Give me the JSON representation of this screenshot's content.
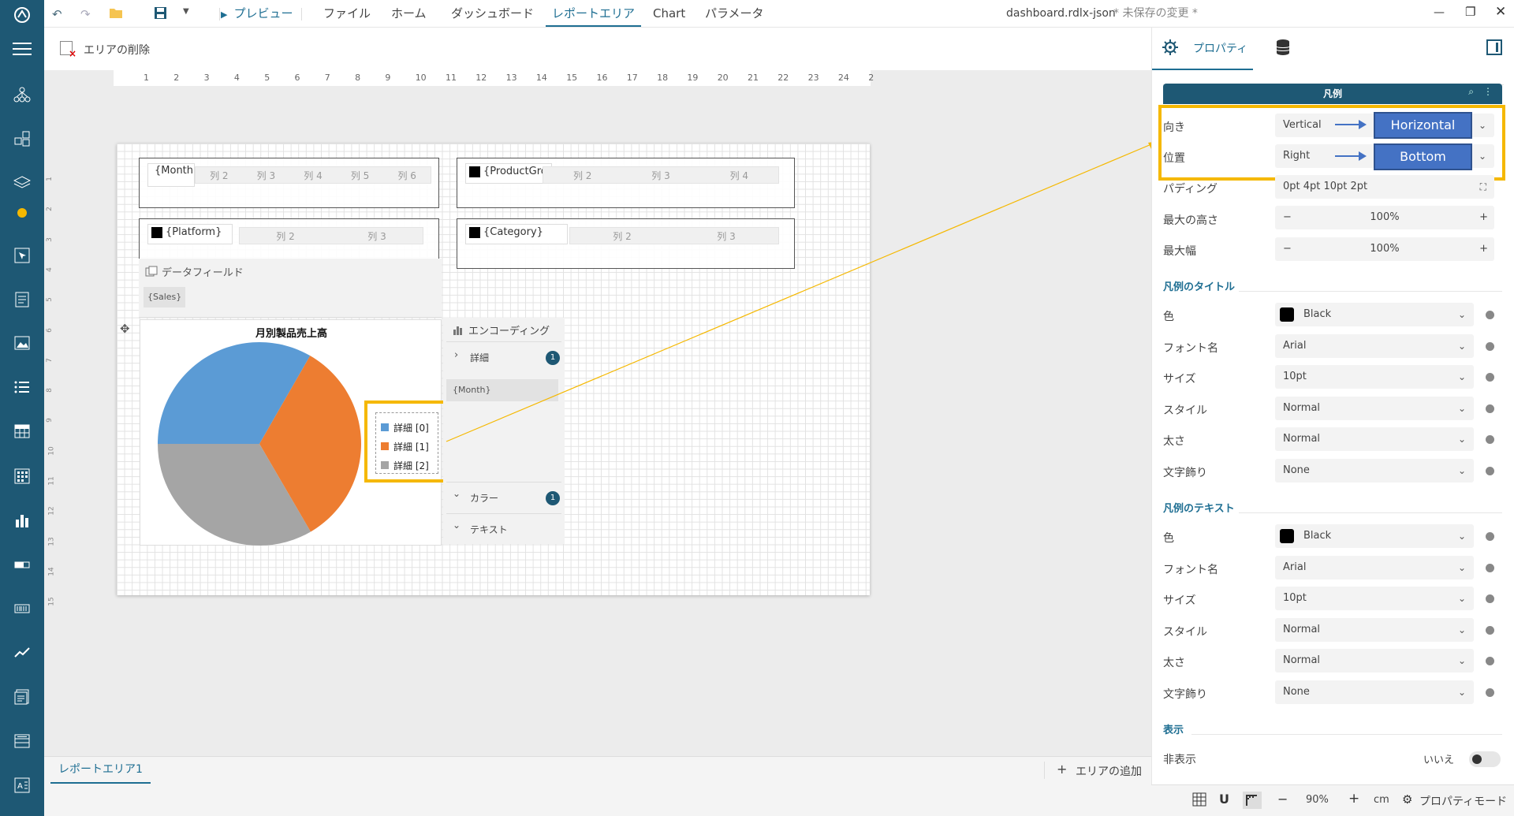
{
  "toolbar": {
    "undo_icon": "undo-icon",
    "redo_icon": "redo-icon",
    "open_icon": "folder-icon",
    "save_icon": "save-icon",
    "preview": "プレビュー",
    "menu": [
      "ファイル",
      "ホーム",
      "ダッシュボード",
      "レポートエリア",
      "Chart",
      "パラメータ"
    ],
    "active_menu": "レポートエリア",
    "filename": "dashboard.rdlx-json",
    "unsaved": "* 未保存の変更 *"
  },
  "subbar": {
    "delete_area": "エリアの削除"
  },
  "ruler_numbers": [
    "1",
    "2",
    "3",
    "4",
    "5",
    "6",
    "7",
    "8",
    "9",
    "10",
    "11",
    "12",
    "13",
    "14",
    "15",
    "16",
    "17",
    "18",
    "19",
    "20",
    "21",
    "22",
    "23",
    "24",
    "2"
  ],
  "ruler_v_numbers": [
    "1",
    "2",
    "3",
    "4",
    "5",
    "6",
    "7",
    "8",
    "9",
    "10",
    "11",
    "12",
    "13",
    "14",
    "15"
  ],
  "tables": {
    "t1": {
      "field": "{Month}",
      "cols": [
        "列 2",
        "列 3",
        "列 4",
        "列 5",
        "列 6"
      ]
    },
    "t2": {
      "field": "{ProductGrc",
      "cols": [
        "列 2",
        "列 3",
        "列 4"
      ]
    },
    "t3": {
      "field": "{Platform}",
      "cols": [
        "列 2",
        "列 3"
      ]
    },
    "t4": {
      "field": "{Category}",
      "cols": [
        "列 2",
        "列 3"
      ]
    }
  },
  "datafield": {
    "label": "データフィールド",
    "value": "{Sales}"
  },
  "chart": {
    "title": "月別製品売上高",
    "legend": [
      "詳細 [0]",
      "詳細 [1]",
      "詳細 [2]"
    ],
    "colors": [
      "#5b9bd5",
      "#ed7d31",
      "#a5a5a5"
    ]
  },
  "chart_data": {
    "type": "pie",
    "title": "月別製品売上高",
    "categories": [
      "詳細 [0]",
      "詳細 [1]",
      "詳細 [2]"
    ],
    "values": [
      33.3,
      33.3,
      33.4
    ],
    "legend_position": "right"
  },
  "encoding": {
    "title": "エンコーディング",
    "detail": "詳細",
    "detail_count": "1",
    "detail_value": "{Month}",
    "color": "カラー",
    "color_count": "1",
    "text": "テキスト"
  },
  "props_panel": {
    "tab_label": "プロパティ",
    "header": "凡例",
    "orientation_label": "向き",
    "orientation_old": "Vertical",
    "orientation_new": "Horizontal",
    "position_label": "位置",
    "position_old": "Right",
    "position_new": "Bottom",
    "padding_label": "パディング",
    "padding_value": "0pt 4pt 10pt 2pt",
    "maxh_label": "最大の高さ",
    "maxh_value": "100%",
    "maxw_label": "最大幅",
    "maxw_value": "100%",
    "title_section": "凡例のタイトル",
    "text_section": "凡例のテキスト",
    "color_label": "色",
    "color_value": "Black",
    "font_label": "フォント名",
    "font_value": "Arial",
    "size_label": "サイズ",
    "size_value": "10pt",
    "style_label": "スタイル",
    "style_value": "Normal",
    "weight_label": "太さ",
    "weight_value": "Normal",
    "decoration_label": "文字飾り",
    "decoration_value": "None",
    "display_section": "表示",
    "hidden_label": "非表示",
    "hidden_value": "いいえ"
  },
  "bottom": {
    "tab": "レポートエリア1",
    "add_area": "エリアの追加",
    "zoom": "90%",
    "unit": "cm",
    "prop_mode": "プロパティモード"
  }
}
